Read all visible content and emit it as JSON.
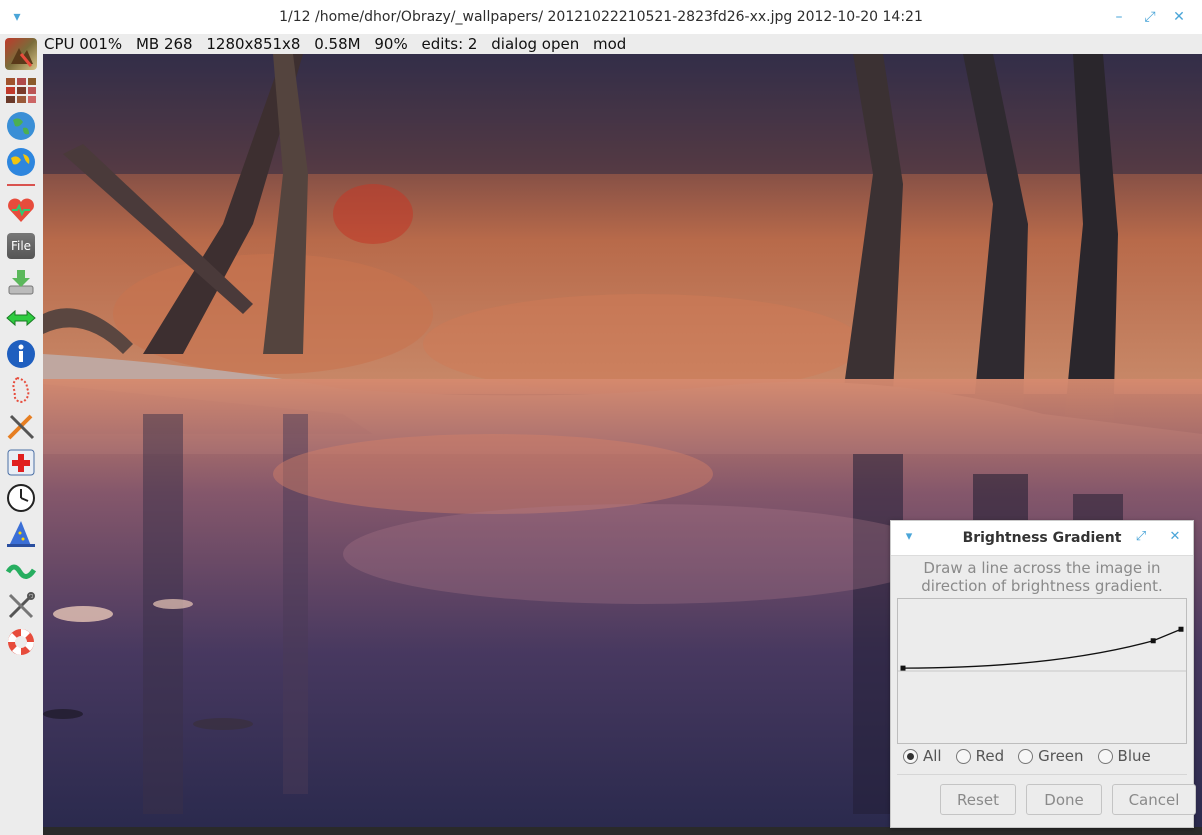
{
  "window": {
    "title": "1/12  /home/dhor/Obrazy/_wallpapers/  20121022210521-2823fd26-xx.jpg  2012-10-20 14:21",
    "menu_icon": "chevron-down-icon",
    "controls": [
      "minimize-icon",
      "maximize-icon",
      "close-icon"
    ]
  },
  "status": {
    "cpu": "CPU 001%",
    "mb": "MB 268",
    "dims": "1280x851x8",
    "size": "0.58M",
    "zoom": "90%",
    "edits": "edits: 2",
    "dialog": "dialog open",
    "mod": "mod"
  },
  "toolbar": {
    "file_label": "File",
    "tools": [
      "image-thumbnail-icon",
      "gallery-icon",
      "globe-icon",
      "world-map-icon",
      "separator-line",
      "favorites-heart-icon",
      "file-menu-icon",
      "save-download-icon",
      "resize-arrows-icon",
      "info-icon",
      "select-lasso-icon",
      "edit-tools-icon",
      "plugins-add-icon",
      "clock-icon",
      "wizard-hat-icon",
      "warp-icon",
      "settings-tools-icon",
      "help-lifebuoy-icon"
    ]
  },
  "dialog": {
    "title": "Brightness Gradient",
    "instruction": "Draw a line across the image in direction of brightness gradient.",
    "radios": [
      {
        "label": "All",
        "checked": true
      },
      {
        "label": "Red",
        "checked": false
      },
      {
        "label": "Green",
        "checked": false
      },
      {
        "label": "Blue",
        "checked": false
      }
    ],
    "buttons": {
      "reset": "Reset",
      "done": "Done",
      "cancel": "Cancel"
    },
    "curve_nodes": [
      [
        0.0,
        0.52
      ],
      [
        0.9,
        0.71
      ],
      [
        1.0,
        0.79
      ]
    ],
    "accent_color": "#4aa5d8"
  }
}
